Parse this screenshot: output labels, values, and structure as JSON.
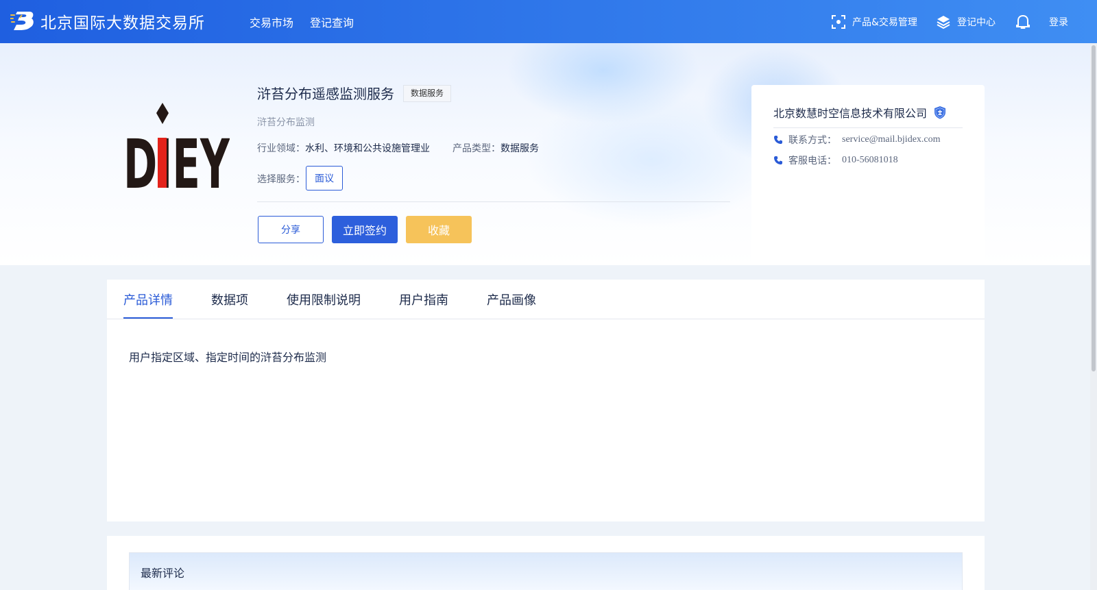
{
  "header": {
    "site_name": "北京国际大数据交易所",
    "nav": [
      {
        "label": "交易市场"
      },
      {
        "label": "登记查询"
      }
    ],
    "actions": {
      "product_trade": "产品&交易管理",
      "registry_center": "登记中心",
      "login": "登录"
    }
  },
  "product": {
    "logo_text": "DIEY",
    "title": "浒苔分布遥感监测服务",
    "type_tag": "数据服务",
    "subtitle": "浒苔分布监测",
    "industry_label": "行业领域：",
    "industry_value": "水利、环境和公共设施管理业",
    "product_type_label": "产品类型：",
    "product_type_value": "数据服务",
    "service_label": "选择服务：",
    "service_option": "面议",
    "buttons": {
      "share": "分享",
      "sign": "立即签约",
      "favorite": "收藏"
    }
  },
  "company": {
    "name": "北京数慧时空信息技术有限公司",
    "contact_label": "联系方式：",
    "contact_value": "service@mail.bjidex.com",
    "phone_label": "客服电话：",
    "phone_value": "010-56081018"
  },
  "tabs": [
    {
      "label": "产品详情",
      "active": true
    },
    {
      "label": "数据项"
    },
    {
      "label": "使用限制说明"
    },
    {
      "label": "用户指南"
    },
    {
      "label": "产品画像"
    }
  ],
  "detail": {
    "description": "用户指定区域、指定时间的浒苔分布监测"
  },
  "comments": {
    "title": "最新评论"
  },
  "colors": {
    "header_start": "#1f5fe0",
    "header_end": "#3f8ef3",
    "primary": "#2a5bd7",
    "favorite": "#f6c35a"
  }
}
